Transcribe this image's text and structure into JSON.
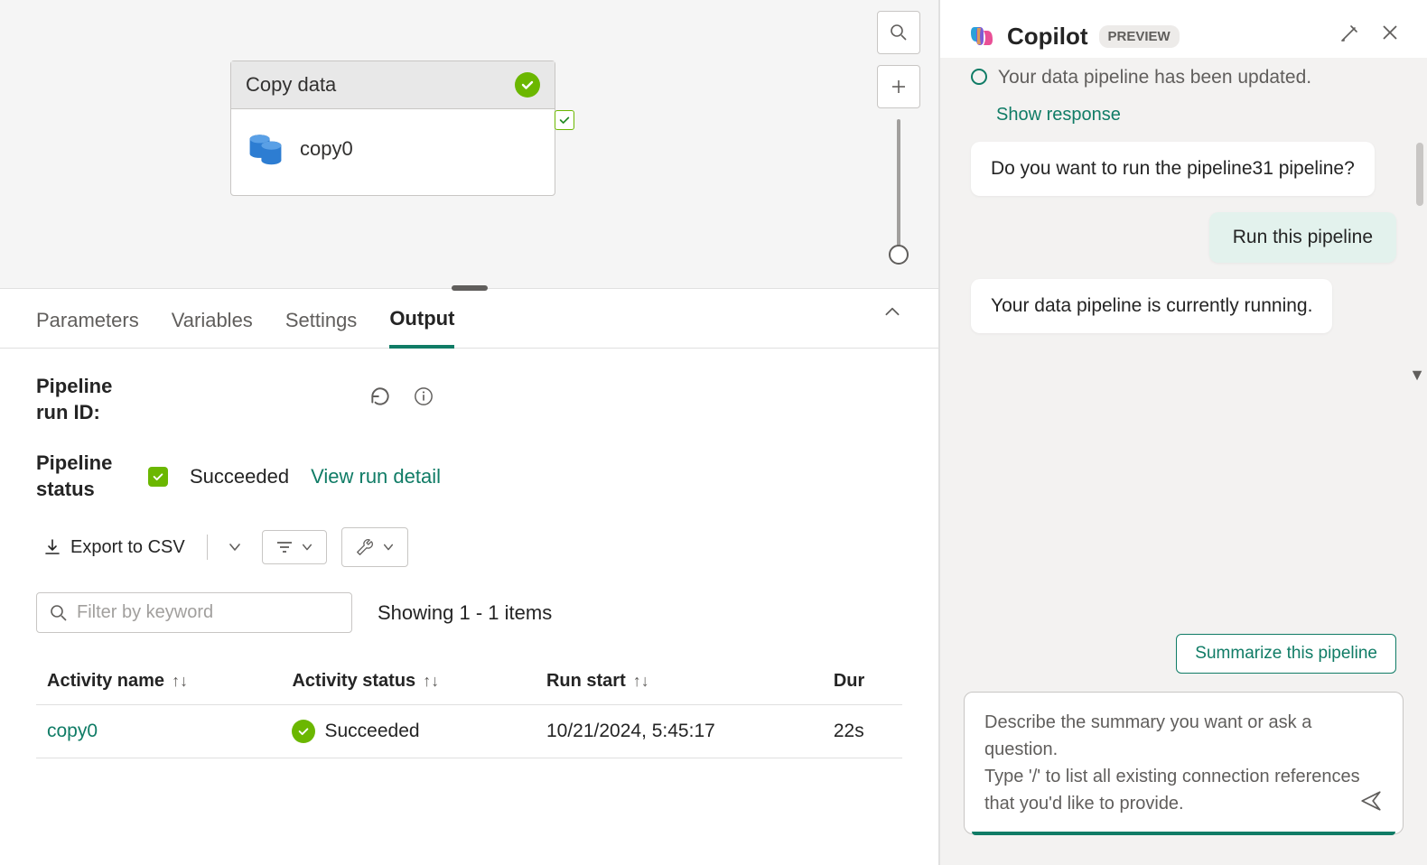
{
  "canvas": {
    "node": {
      "title": "Copy data",
      "name": "copy0"
    }
  },
  "tabs": [
    "Parameters",
    "Variables",
    "Settings",
    "Output"
  ],
  "activeTab": "Output",
  "output": {
    "runIdLabel": "Pipeline run ID:",
    "statusLabel": "Pipeline status",
    "status": "Succeeded",
    "viewDetail": "View run detail",
    "exportCsv": "Export to CSV",
    "filterPlaceholder": "Filter by keyword",
    "showing": "Showing 1 - 1 items",
    "columns": {
      "activityName": "Activity name",
      "activityStatus": "Activity status",
      "runStart": "Run start",
      "duration": "Dur"
    },
    "rows": [
      {
        "name": "copy0",
        "status": "Succeeded",
        "start": "10/21/2024, 5:45:17",
        "duration": "22s"
      }
    ]
  },
  "copilot": {
    "title": "Copilot",
    "preview": "PREVIEW",
    "truncated": "Your data pipeline has been updated.",
    "showResponse": "Show response",
    "msg1": "Do you want to run the pipeline31 pipeline?",
    "userMsg": "Run this pipeline",
    "msg2": "Your data pipeline is currently running.",
    "summarize": "Summarize this pipeline",
    "inputPlaceholder": "Describe the summary you want or ask a question.\nType '/' to list all existing connection references that you'd like to provide."
  }
}
